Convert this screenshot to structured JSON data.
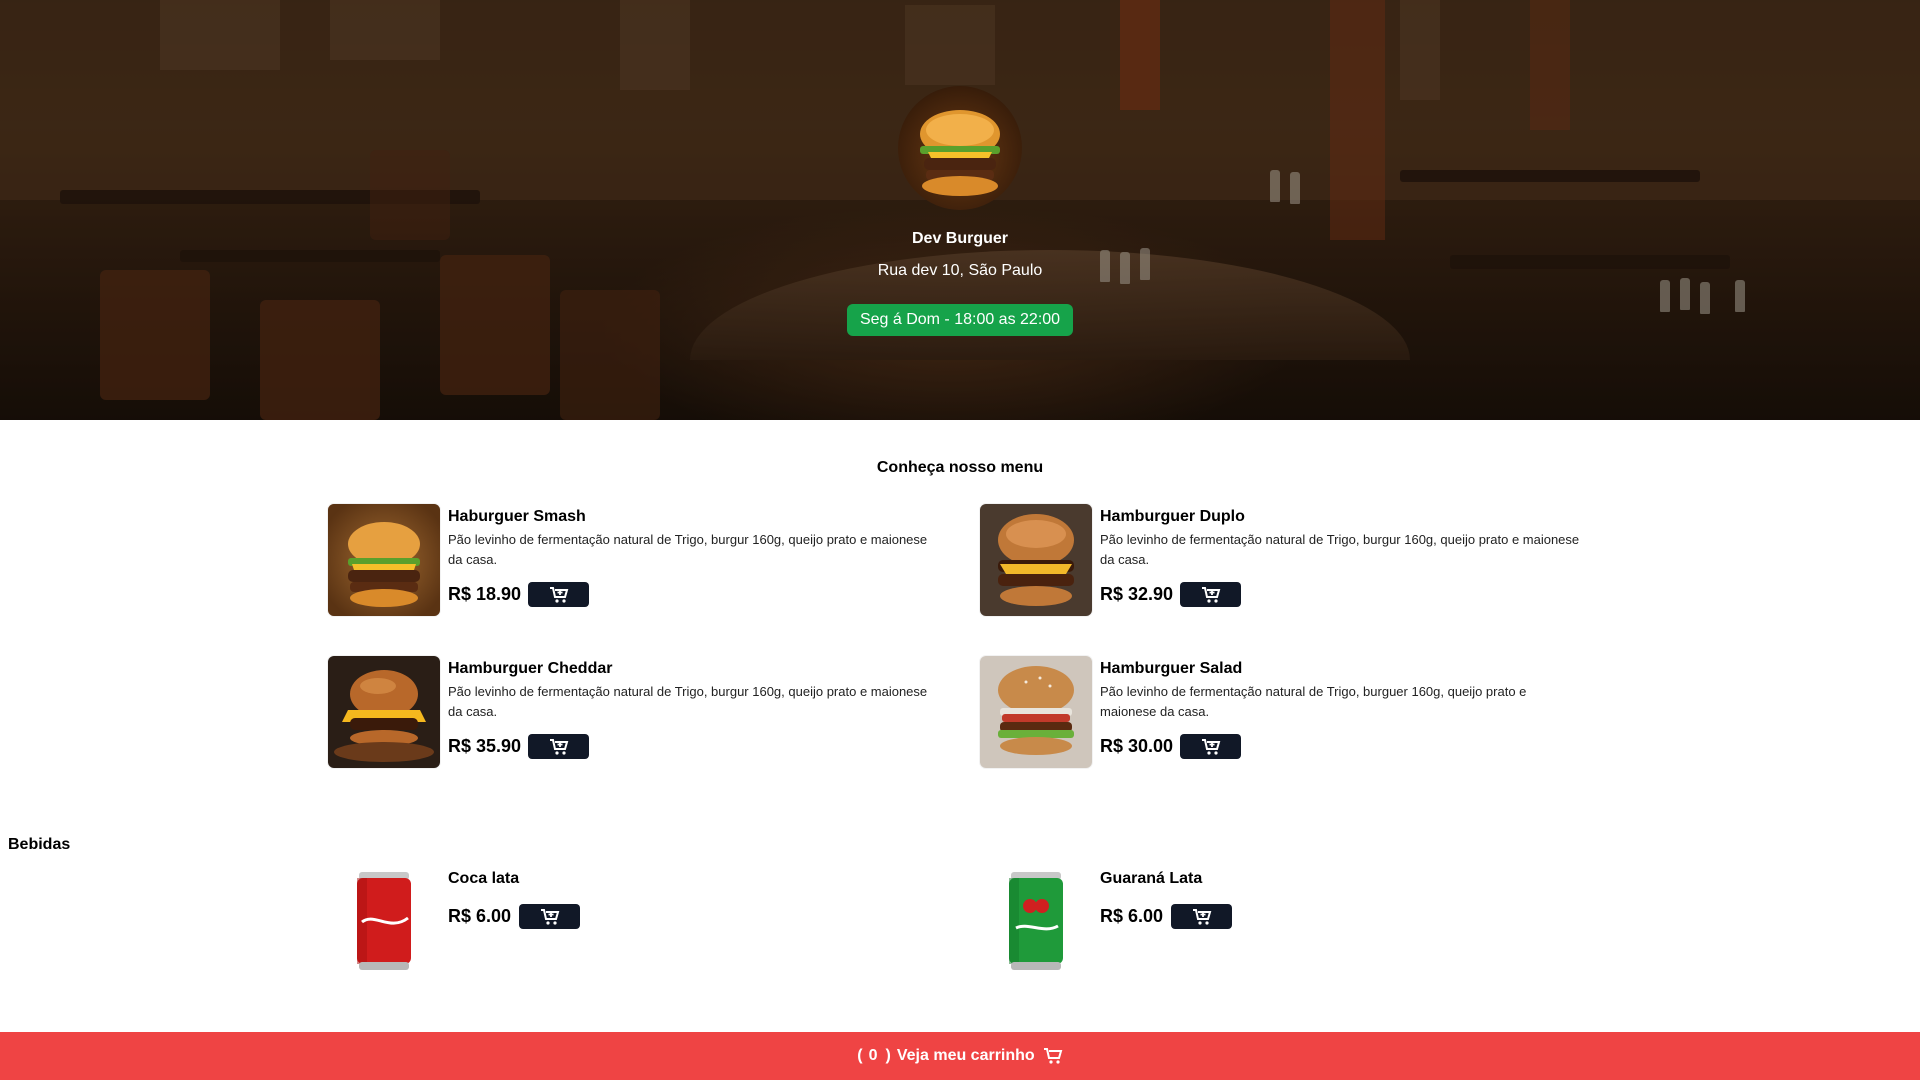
{
  "header": {
    "brand_name": "Dev Burguer",
    "address": "Rua dev 10, São Paulo",
    "hours": "Seg á Dom - 18:00 as 22:00",
    "hours_color": "#16a34a"
  },
  "menu": {
    "title": "Conheça nosso menu",
    "items": [
      {
        "name": "Haburguer Smash",
        "description": "Pão levinho de fermentação natural de Trigo, burgur 160g, queijo prato e maionese da casa.",
        "price": "R$ 18.90"
      },
      {
        "name": "Hamburguer Duplo",
        "description": "Pão levinho de fermentação natural de Trigo, burgur 160g, queijo prato e maionese da casa.",
        "price": "R$ 32.90"
      },
      {
        "name": "Hamburguer Cheddar",
        "description": "Pão levinho de fermentação natural de Trigo, burgur 160g, queijo prato e maionese da casa.",
        "price": "R$ 35.90"
      },
      {
        "name": "Hamburguer Salad",
        "description": "Pão levinho de fermentação natural de Trigo, burguer 160g, queijo prato e maionese da casa.",
        "price": "R$ 30.00"
      }
    ]
  },
  "drinks": {
    "title": "Bebidas",
    "items": [
      {
        "name": "Coca lata",
        "price": "R$ 6.00"
      },
      {
        "name": "Guaraná Lata",
        "price": "R$ 6.00"
      }
    ]
  },
  "footer": {
    "open_paren": "(",
    "count": "0",
    "close_paren": ")",
    "label": "Veja meu carrinho",
    "color": "#ef4444"
  },
  "icons": {
    "cart": "cart-plus-icon",
    "footer_cart": "cart-icon"
  },
  "colors": {
    "button": "#111827",
    "hours_badge": "#16a34a",
    "footer": "#ef4444"
  }
}
